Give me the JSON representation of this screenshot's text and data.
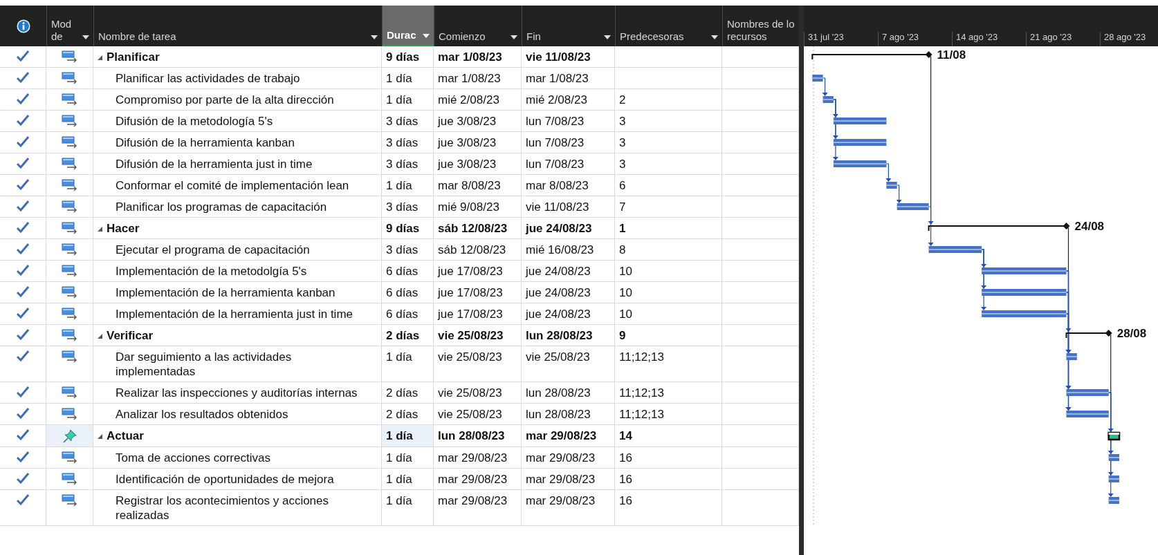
{
  "columns": [
    {
      "kind": "info",
      "dropdown": false,
      "selected": false
    },
    {
      "kind": "mode",
      "label": "Mod\nde",
      "dropdown": true,
      "selected": false
    },
    {
      "kind": "name",
      "label": "Nombre de tarea",
      "dropdown": true,
      "selected": false
    },
    {
      "kind": "duration",
      "label": "Durac",
      "dropdown": true,
      "selected": true
    },
    {
      "kind": "start",
      "label": "Comienzo",
      "dropdown": true,
      "selected": false
    },
    {
      "kind": "finish",
      "label": "Fin",
      "dropdown": true,
      "selected": false
    },
    {
      "kind": "predecessors",
      "label": "Predecesoras",
      "dropdown": true,
      "selected": false
    },
    {
      "kind": "resources",
      "label": "Nombres de lo\nrecursos",
      "dropdown": false,
      "selected": false
    }
  ],
  "timescale": [
    "31 jul '23",
    "7 ago '23",
    "14 ago '23",
    "21 ago '23",
    "28 ago '23"
  ],
  "rows": [
    {
      "kind": "summary",
      "manual": false,
      "done": true,
      "selected": false,
      "name": "Planificar",
      "duration": "9 días",
      "start": "mar 1/08/23",
      "finish": "vie 11/08/23",
      "predecessors": "",
      "gantt_label": "11/08"
    },
    {
      "kind": "task",
      "manual": false,
      "done": true,
      "selected": false,
      "name": "Planificar las actividades de trabajo",
      "duration": "1 día",
      "start": "mar 1/08/23",
      "finish": "mar 1/08/23",
      "predecessors": ""
    },
    {
      "kind": "task",
      "manual": false,
      "done": true,
      "selected": false,
      "name": "Compromiso por parte de la alta dirección",
      "duration": "1 día",
      "start": "mié 2/08/23",
      "finish": "mié 2/08/23",
      "predecessors": "2"
    },
    {
      "kind": "task",
      "manual": false,
      "done": true,
      "selected": false,
      "name": "Difusión de la metodología 5's",
      "duration": "3 días",
      "start": "jue 3/08/23",
      "finish": "lun 7/08/23",
      "predecessors": "3"
    },
    {
      "kind": "task",
      "manual": false,
      "done": true,
      "selected": false,
      "name": "Difusión de la herramienta kanban",
      "duration": "3 días",
      "start": "jue 3/08/23",
      "finish": "lun 7/08/23",
      "predecessors": "3"
    },
    {
      "kind": "task",
      "manual": false,
      "done": true,
      "selected": false,
      "name": "Difusión de la herramienta just in time",
      "duration": "3 días",
      "start": "jue 3/08/23",
      "finish": "lun 7/08/23",
      "predecessors": "3"
    },
    {
      "kind": "task",
      "manual": false,
      "done": true,
      "selected": false,
      "name": "Conformar el comité de implementación lean",
      "duration": "1 día",
      "start": "mar 8/08/23",
      "finish": "mar 8/08/23",
      "predecessors": "6"
    },
    {
      "kind": "task",
      "manual": false,
      "done": true,
      "selected": false,
      "name": "Planificar los programas de capacitación",
      "duration": "3 días",
      "start": "mié 9/08/23",
      "finish": "vie 11/08/23",
      "predecessors": "7"
    },
    {
      "kind": "summary",
      "manual": false,
      "done": true,
      "selected": false,
      "name": "Hacer",
      "duration": "9 días",
      "start": "sáb 12/08/23",
      "finish": "jue 24/08/23",
      "predecessors": "1",
      "gantt_label": "24/08"
    },
    {
      "kind": "task",
      "manual": false,
      "done": true,
      "selected": false,
      "name": "Ejecutar el programa de capacitación",
      "duration": "3 días",
      "start": "sáb 12/08/23",
      "finish": "mié 16/08/23",
      "predecessors": "8"
    },
    {
      "kind": "task",
      "manual": false,
      "done": true,
      "selected": false,
      "name": "Implementación de la metodolgía 5's",
      "duration": "6 días",
      "start": "jue 17/08/23",
      "finish": "jue 24/08/23",
      "predecessors": "10"
    },
    {
      "kind": "task",
      "manual": false,
      "done": true,
      "selected": false,
      "name": "Implementación de la herramienta kanban",
      "duration": "6 días",
      "start": "jue 17/08/23",
      "finish": "jue 24/08/23",
      "predecessors": "10"
    },
    {
      "kind": "task",
      "manual": false,
      "done": true,
      "selected": false,
      "name": "Implementación de la herramienta just in time",
      "duration": "6 días",
      "start": "jue 17/08/23",
      "finish": "jue 24/08/23",
      "predecessors": "10"
    },
    {
      "kind": "summary",
      "manual": false,
      "done": true,
      "selected": false,
      "name": "Verificar",
      "duration": "2 días",
      "start": "vie 25/08/23",
      "finish": "lun 28/08/23",
      "predecessors": "9",
      "gantt_label": "28/08"
    },
    {
      "kind": "task",
      "manual": false,
      "done": true,
      "selected": false,
      "name": "Dar seguimiento a las actividades implementadas",
      "duration": "1 día",
      "start": "vie 25/08/23",
      "finish": "vie 25/08/23",
      "predecessors": "11;12;13"
    },
    {
      "kind": "task",
      "manual": false,
      "done": true,
      "selected": false,
      "name": "Realizar las inspecciones y auditorías internas",
      "duration": "2 días",
      "start": "vie 25/08/23",
      "finish": "lun 28/08/23",
      "predecessors": "11;12;13"
    },
    {
      "kind": "task",
      "manual": false,
      "done": true,
      "selected": false,
      "name": "Analizar los resultados obtenidos",
      "duration": "2 días",
      "start": "vie 25/08/23",
      "finish": "lun 28/08/23",
      "predecessors": "11;12;13"
    },
    {
      "kind": "summary",
      "manual": true,
      "done": true,
      "selected": true,
      "name": "Actuar",
      "duration": "1 día",
      "start": "lun 28/08/23",
      "finish": "mar 29/08/23",
      "predecessors": "14"
    },
    {
      "kind": "task",
      "manual": false,
      "done": true,
      "selected": false,
      "name": "Toma de acciones correctivas",
      "duration": "1 día",
      "start": "mar 29/08/23",
      "finish": "mar 29/08/23",
      "predecessors": "16"
    },
    {
      "kind": "task",
      "manual": false,
      "done": true,
      "selected": false,
      "name": "Identificación de oportunidades de mejora",
      "duration": "1 día",
      "start": "mar 29/08/23",
      "finish": "mar 29/08/23",
      "predecessors": "16"
    },
    {
      "kind": "task",
      "manual": false,
      "done": true,
      "selected": false,
      "name": "Registrar los acontecimientos y acciones realizadas",
      "duration": "1 día",
      "start": "mar 29/08/23",
      "finish": "mar 29/08/23",
      "predecessors": "16"
    }
  ]
}
